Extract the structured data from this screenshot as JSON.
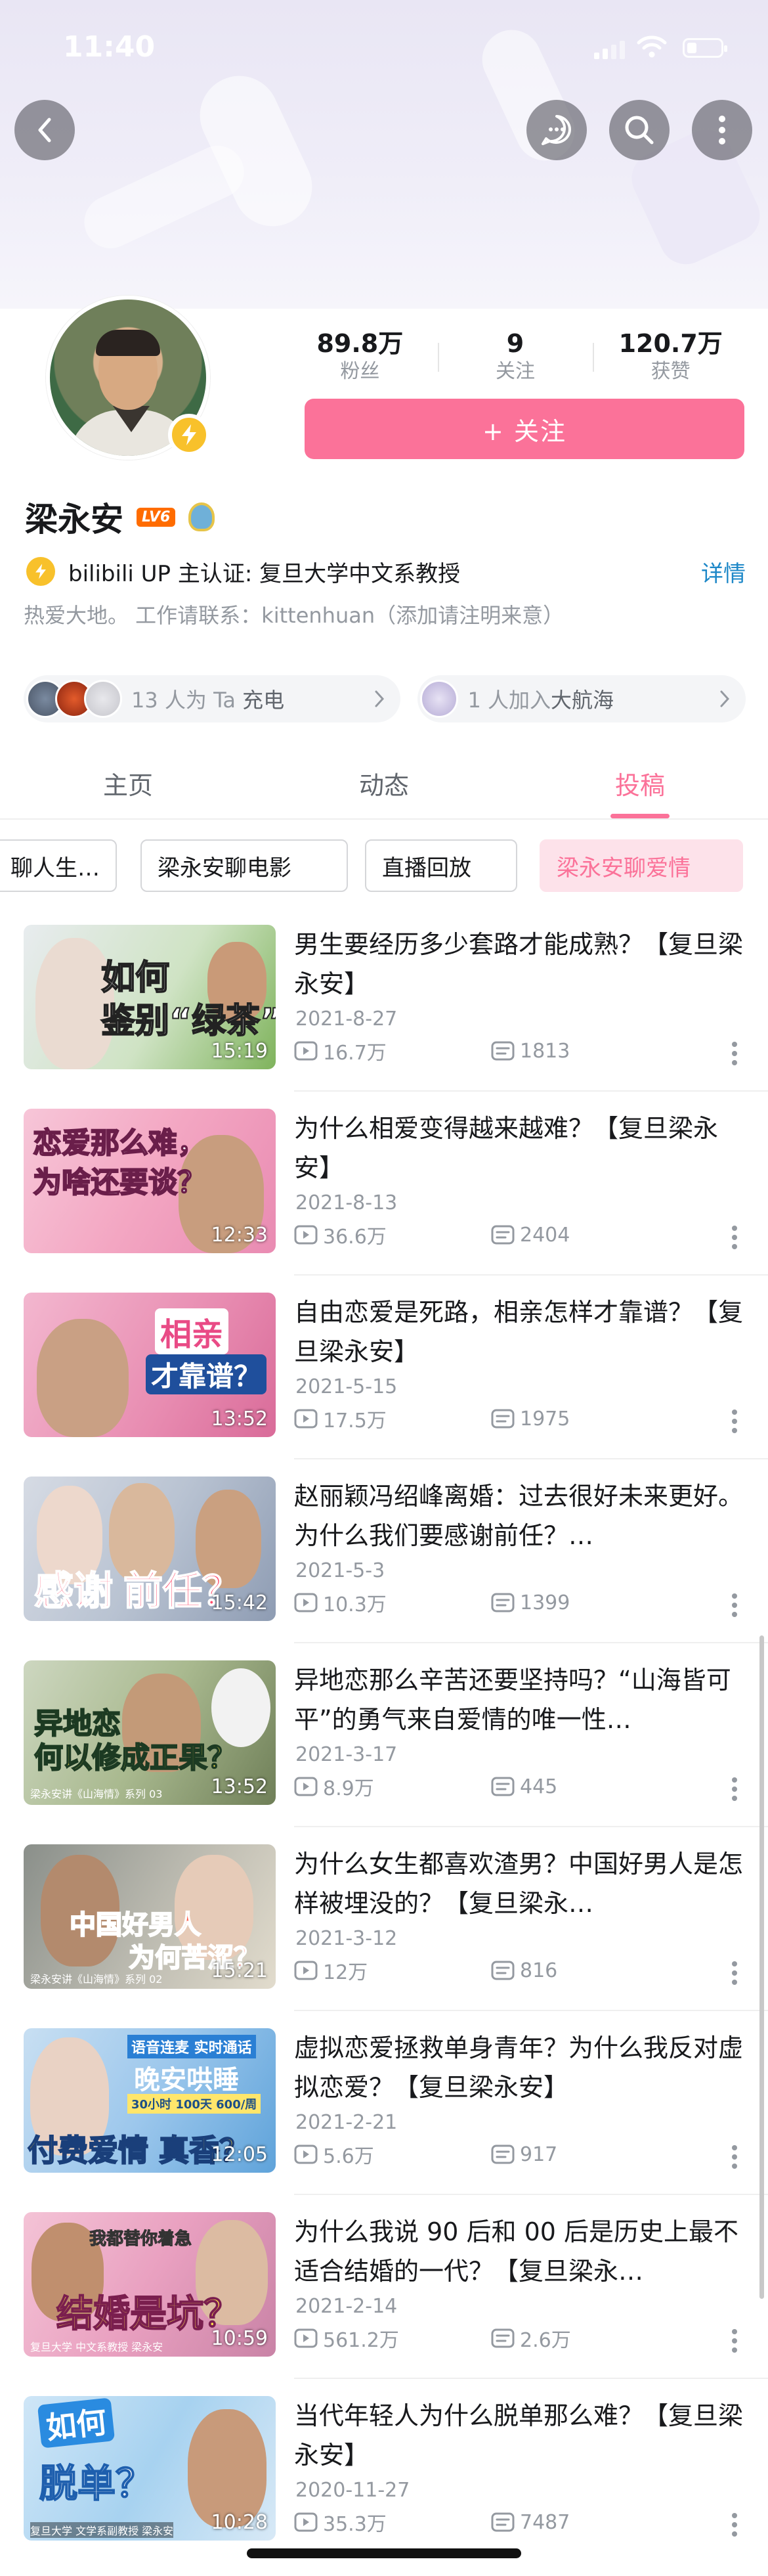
{
  "status_bar": {
    "time": "11:40"
  },
  "profile": {
    "name": "梁永安",
    "level_badge": "LV6",
    "stats": [
      {
        "value": "89.8万",
        "label": "粉丝"
      },
      {
        "value": "9",
        "label": "关注"
      },
      {
        "value": "120.7万",
        "label": "获赞"
      }
    ],
    "follow_label": "+ 关注",
    "certification": "bilibili UP 主认证: 复旦大学中文系教授",
    "details_label": "详情",
    "bio": "热爱大地。 工作请联系：kittenhuan（添加请注明来意）",
    "charge_pill": {
      "prefix": "13 人为 Ta ",
      "strong": "充电"
    },
    "voyage_pill": {
      "prefix": "1 人加入",
      "strong": "大航海"
    }
  },
  "tabs": [
    {
      "label": "主页",
      "active": false
    },
    {
      "label": "动态",
      "active": false
    },
    {
      "label": "投稿",
      "active": true
    }
  ],
  "collections": [
    "聊人生…",
    "梁永安聊电影",
    "直播回放",
    "梁永安聊爱情"
  ],
  "videos": [
    {
      "title": "男生要经历多少套路才能成熟？【复旦梁永安】",
      "date": "2021-8-27",
      "plays": "16.7万",
      "danmaku": "1813",
      "duration": "15:19",
      "thumb_text": [
        "如何",
        "鉴别“绿茶”"
      ]
    },
    {
      "title": "为什么相爱变得越来越难？【复旦梁永安】",
      "date": "2021-8-13",
      "plays": "36.6万",
      "danmaku": "2404",
      "duration": "12:33",
      "thumb_text": [
        "恋爱那么难，",
        "为啥还要谈？"
      ]
    },
    {
      "title": "自由恋爱是死路，相亲怎样才靠谱？【复旦梁永安】",
      "date": "2021-5-15",
      "plays": "17.5万",
      "danmaku": "1975",
      "duration": "13:52",
      "thumb_text": [
        "相亲",
        "才靠谱？"
      ]
    },
    {
      "title": "赵丽颖冯绍峰离婚：过去很好未来更好。为什么我们要感谢前任？…",
      "date": "2021-5-3",
      "plays": "10.3万",
      "danmaku": "1399",
      "duration": "15:42",
      "thumb_text": [
        "感谢",
        "前任？"
      ]
    },
    {
      "title": "异地恋那么辛苦还要坚持吗？“山海皆可平”的勇气来自爱情的唯一性…",
      "date": "2021-3-17",
      "plays": "8.9万",
      "danmaku": "445",
      "duration": "13:52",
      "thumb_text": [
        "异地恋",
        "何以修成正果？",
        "梁永安讲《山海情》系列 03"
      ]
    },
    {
      "title": "为什么女生都喜欢渣男？中国好男人是怎样被埋没的？【复旦梁永…",
      "date": "2021-3-12",
      "plays": "12万",
      "danmaku": "816",
      "duration": "15:21",
      "thumb_text": [
        "中国好男人",
        "为何苦涩？",
        "梁永安讲《山海情》系列 02"
      ]
    },
    {
      "title": "虚拟恋爱拯救单身青年？为什么我反对虚拟恋爱？【复旦梁永安】",
      "date": "2021-2-21",
      "plays": "5.6万",
      "danmaku": "917",
      "duration": "12:05",
      "thumb_text": [
        "语音连麦 实时通话",
        "晚安哄睡",
        "30小时 100天 600/周",
        "付费爱情 真香？"
      ]
    },
    {
      "title": "为什么我说 90 后和 00 后是历史上最不适合结婚的一代？【复旦梁永…",
      "date": "2021-2-14",
      "plays": "561.2万",
      "danmaku": "2.6万",
      "duration": "10:59",
      "thumb_text": [
        "我都替你着急",
        "结婚是坑？",
        "复旦大学 中文系教授 梁永安"
      ]
    },
    {
      "title": "当代年轻人为什么脱单那么难？【复旦梁永安】",
      "date": "2020-11-27",
      "plays": "35.3万",
      "danmaku": "7487",
      "duration": "10:28",
      "thumb_text": [
        "如何",
        "脱单？",
        "复旦大学 文学系副教授 梁永安"
      ]
    }
  ],
  "colors": {
    "accent_pink": "#fb7299",
    "verify_gold": "#f8c12b",
    "link_blue": "#1e88c8",
    "secondary_gray": "#9499a0"
  }
}
